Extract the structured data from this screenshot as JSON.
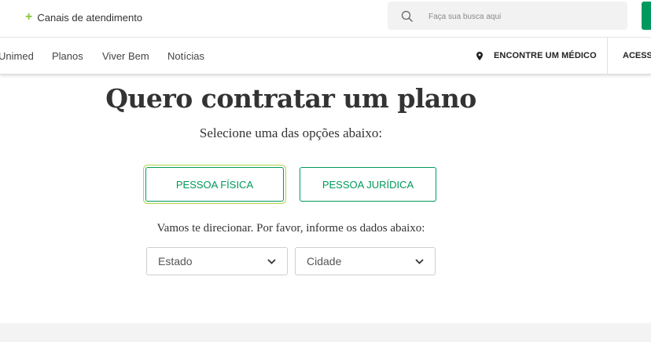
{
  "topbar": {
    "canais_label": "Canais de atendimento",
    "search_placeholder": "Faça sua busca aqui"
  },
  "nav": {
    "items": [
      "Unimed",
      "Planos",
      "Viver Bem",
      "Notícias"
    ],
    "encontre_medico": "ENCONTRE UM MÉDICO",
    "acesso": "ACESSO"
  },
  "main": {
    "title": "Quero contratar um plano",
    "subtitle": "Selecione uma das opções abaixo:",
    "options": [
      "PESSOA FÍSICA",
      "PESSOA JURÍDICA"
    ],
    "selected_option": "PESSOA FÍSICA",
    "instruction": "Vamos te direcionar. Por favor, informe os dados abaixo:",
    "estado_value": "Estado",
    "cidade_value": "Cidade"
  },
  "colors": {
    "brand_green": "#00995d",
    "plus_green": "#8dc63f",
    "selected_outline": "#b1d34b"
  },
  "icons": [
    "plus-icon",
    "search-icon",
    "location-pin-icon",
    "chevron-down-icon"
  ]
}
